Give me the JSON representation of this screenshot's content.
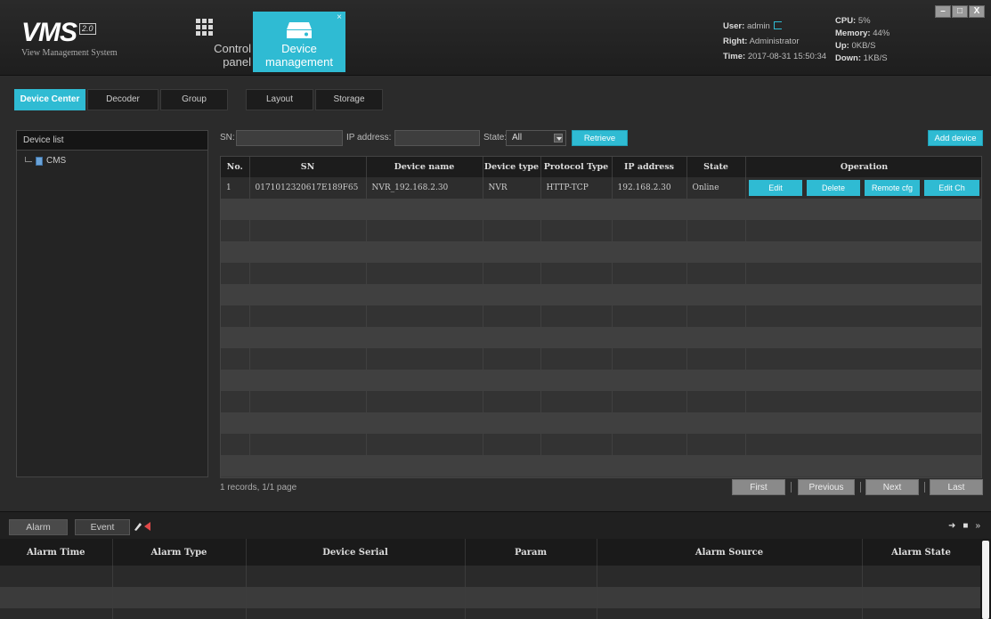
{
  "app": {
    "logo_text": "VMS",
    "logo_version": "2.0",
    "logo_subtitle": "View Management System"
  },
  "nav": {
    "control_panel_line1": "Control",
    "control_panel_line2": "panel",
    "device_mgmt_line1": "Device",
    "device_mgmt_line2": "management",
    "close_glyph": "×"
  },
  "status": {
    "user_label": "User:",
    "user_value": "admin",
    "right_label": "Right:",
    "right_value": "Administrator",
    "time_label": "Time:",
    "time_value": "2017-08-31 15:50:34",
    "cpu_label": "CPU:",
    "cpu_value": "5%",
    "memory_label": "Memory:",
    "memory_value": "44%",
    "up_label": "Up:",
    "up_value": "0KB/S",
    "down_label": "Down:",
    "down_value": "1KB/S"
  },
  "window_buttons": {
    "minimize": "–",
    "maximize": "□",
    "close": "X"
  },
  "tabs": [
    "Device Center",
    "Decoder",
    "Group",
    "Layout",
    "Storage"
  ],
  "device_list": {
    "title": "Device list",
    "root": "CMS"
  },
  "filter": {
    "sn_label": "SN:",
    "ip_label": "IP address:",
    "state_label": "State:",
    "state_value": "All",
    "retrieve_label": "Retrieve",
    "add_device_label": "Add device"
  },
  "table": {
    "headers": [
      "No.",
      "SN",
      "Device name",
      "Device type",
      "Protocol Type",
      "IP address",
      "State",
      "Operation"
    ],
    "rows": [
      {
        "no": "1",
        "sn": "0171012320617E189F65",
        "name": "NVR_192.168.2.30",
        "type": "NVR",
        "protocol": "HTTP-TCP",
        "ip": "192.168.2.30",
        "state": "Online"
      }
    ],
    "operations": [
      "Edit",
      "Delete",
      "Remote cfg",
      "Edit Ch"
    ]
  },
  "pagination": {
    "records_text": "1 records,  1/1 page",
    "first": "First",
    "previous": "Previous",
    "next": "Next",
    "last": "Last"
  },
  "bottom": {
    "alarm_tab": "Alarm",
    "event_tab": "Event",
    "headers": [
      "Alarm Time",
      "Alarm Type",
      "Device Serial",
      "Param",
      "Alarm Source",
      "Alarm State"
    ]
  },
  "colors": {
    "accent": "#2fbbd3",
    "background": "#2b2b2b",
    "header": "#1e1e1e"
  }
}
